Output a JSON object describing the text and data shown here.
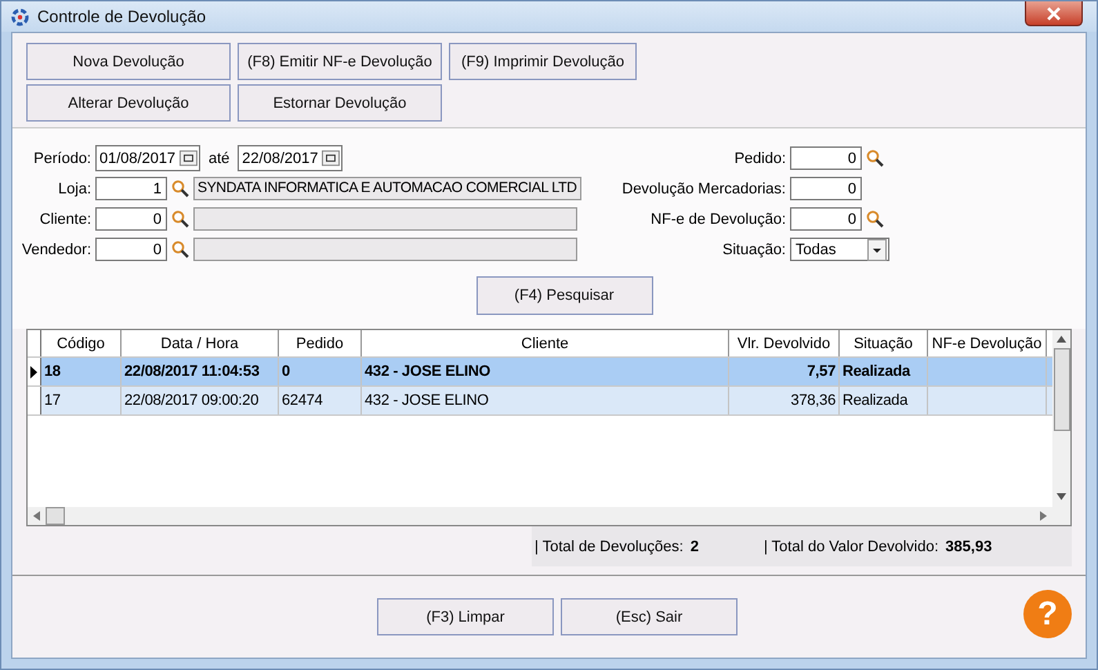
{
  "window": {
    "title": "Controle de Devolução"
  },
  "action_rows": [
    [
      "Nova Devolução",
      "(F8) Emitir NF-e Devolução",
      "(F9) Imprimir Devolução"
    ],
    [
      "Alterar Devolução",
      "Estornar Devolução"
    ]
  ],
  "period": {
    "label": "Período:",
    "from": "01/08/2017",
    "between": "até",
    "to": "22/08/2017"
  },
  "filters_left": [
    {
      "label": "Loja:",
      "value": "1",
      "description": "SYNDATA INFORMATICA E AUTOMACAO COMERCIAL LTD"
    },
    {
      "label": "Cliente:",
      "value": "0"
    },
    {
      "label": "Vendedor:",
      "value": "0"
    }
  ],
  "filters_right": [
    {
      "label": "Pedido:",
      "value": "0",
      "kind": "lookup"
    },
    {
      "label": "Devolução Mercadorias:",
      "value": "0",
      "kind": "plain"
    },
    {
      "label": "NF-e de Devolução:",
      "value": "0",
      "kind": "lookup"
    },
    {
      "label": "Situação:",
      "value": "Todas",
      "kind": "dropdown"
    }
  ],
  "search_button": "(F4) Pesquisar",
  "table": {
    "columns": [
      "Código",
      "Data / Hora",
      "Pedido",
      "Cliente",
      "Vlr. Devolvido",
      "Situação",
      "NF-e Devolução"
    ],
    "rows": [
      {
        "selected": true,
        "cells": [
          "18",
          "22/08/2017 11:04:53",
          "0",
          "432 - JOSE ELINO",
          "7,57",
          "Realizada",
          ""
        ]
      },
      {
        "selected": false,
        "cells": [
          "17",
          "22/08/2017 09:00:20",
          "62474",
          "432 - JOSE ELINO",
          "378,36",
          "Realizada",
          ""
        ]
      }
    ]
  },
  "totals": [
    {
      "label": "| Total de Devoluções:",
      "value": "2"
    },
    {
      "label": "| Total do Valor Devolvido:",
      "value": "385,93"
    }
  ],
  "bottom_buttons": [
    "(F3) Limpar",
    "(Esc) Sair"
  ],
  "help": "?"
}
